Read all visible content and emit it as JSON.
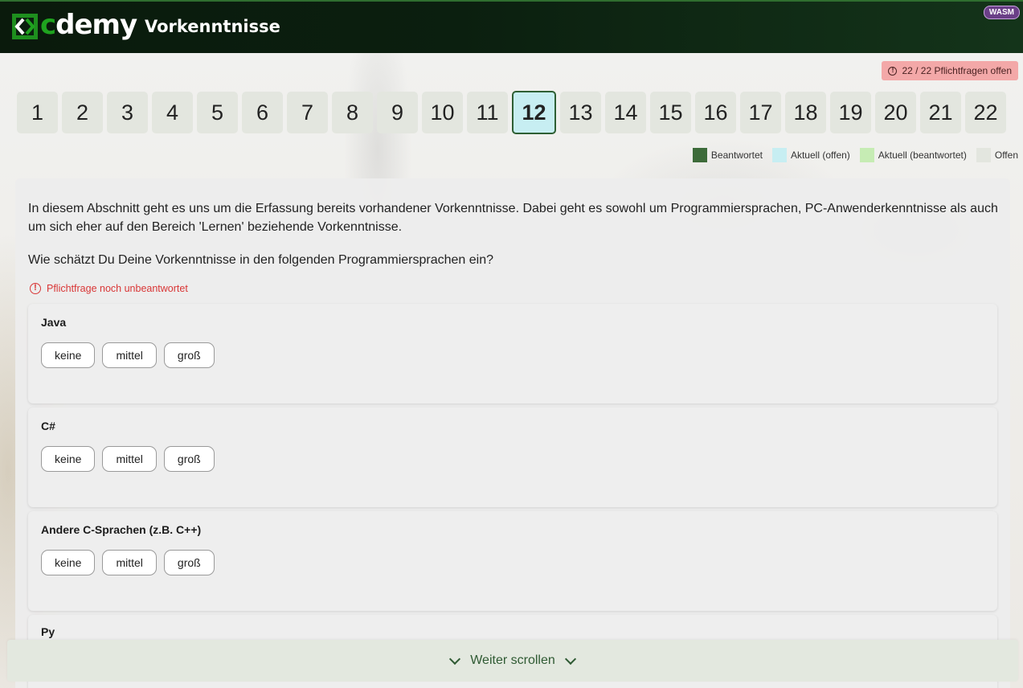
{
  "header": {
    "logo_text_c": "c",
    "logo_text_rest": "demy",
    "title": "Vorkenntnisse",
    "badge": "WASM"
  },
  "status": {
    "pflicht_text": "22 / 22 Pflichtfragen offen"
  },
  "navigation": {
    "pages": [
      "1",
      "2",
      "3",
      "4",
      "5",
      "6",
      "7",
      "8",
      "9",
      "10",
      "11",
      "12",
      "13",
      "14",
      "15",
      "16",
      "17",
      "18",
      "19",
      "20",
      "21",
      "22"
    ],
    "current": "12"
  },
  "legend": [
    {
      "label": "Beantwortet",
      "color": "#3d6b3a"
    },
    {
      "label": "Aktuell (offen)",
      "color": "#c7eef2"
    },
    {
      "label": "Aktuell (beantwortet)",
      "color": "#c6ecb4"
    },
    {
      "label": "Offen",
      "color": "#e3e6df"
    }
  ],
  "section": {
    "intro": "In diesem Abschnitt geht es uns um die Erfassung bereits vorhandener Vorkenntnisse. Dabei geht es sowohl um Programmiersprachen, PC-Anwenderkenntnisse als auch um sich eher auf den Bereich 'Lernen' beziehende Vorkenntnisse.",
    "question": "Wie schätzt Du Deine Vorkenntnisse in den folgenden Programmiersprachen ein?",
    "warning": "Pflichtfrage noch unbeantwortet"
  },
  "options": [
    "keine",
    "mittel",
    "groß"
  ],
  "subquestions": [
    {
      "label": "Java"
    },
    {
      "label": "C#"
    },
    {
      "label": "Andere C-Sprachen (z.B. C++)"
    },
    {
      "label": "Py"
    }
  ],
  "footer": {
    "scroll_label": "Weiter scrollen"
  }
}
